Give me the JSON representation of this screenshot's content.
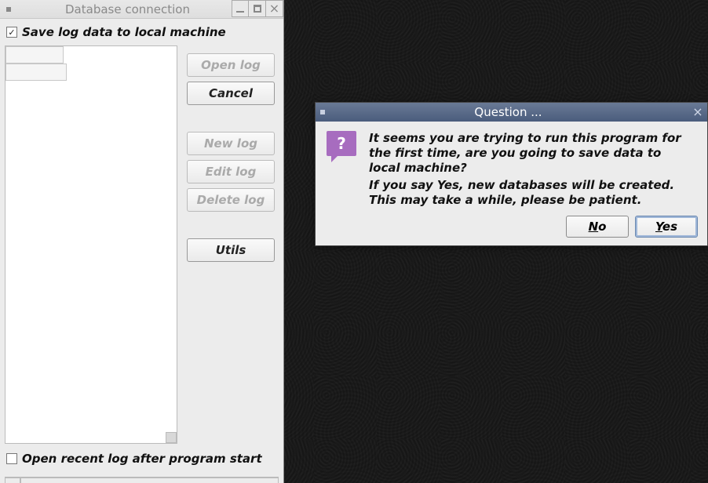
{
  "main_window": {
    "title": "Database connection",
    "save_checkbox": {
      "checked": true,
      "label": "Save log data to local machine"
    },
    "buttons": {
      "open_log": "Open log",
      "cancel": "Cancel",
      "new_log": "New log",
      "edit_log": "Edit log",
      "delete_log": "Delete log",
      "utils": "Utils"
    },
    "open_recent_checkbox": {
      "checked": false,
      "label": "Open recent log after program start"
    }
  },
  "dialog": {
    "title": "Question ...",
    "icon_glyph": "?",
    "message_line1": "It seems you are trying to run this program for the first time, are you going to save data to local machine?",
    "message_line2": "If you say Yes, new databases will be created. This may take a while, please be patient.",
    "no_mnemonic": "N",
    "no_rest": "o",
    "yes_mnemonic": "Y",
    "yes_rest": "es"
  }
}
